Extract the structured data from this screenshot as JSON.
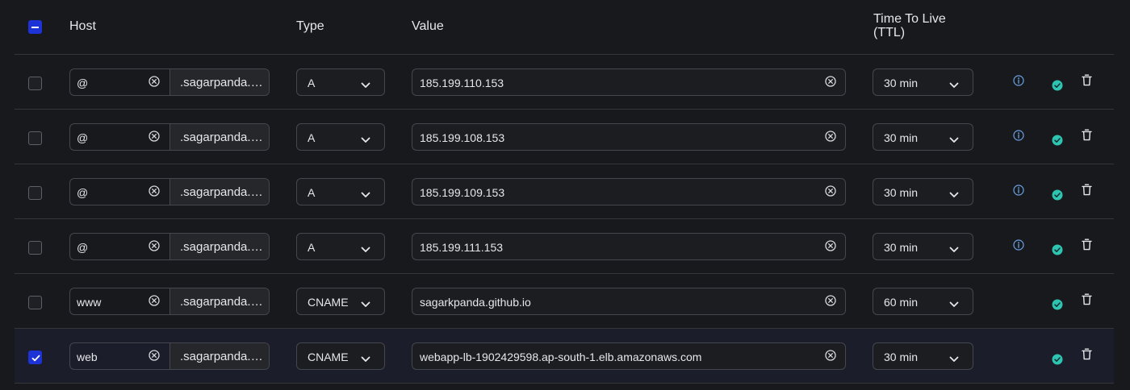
{
  "header": {
    "host": "Host",
    "type": "Type",
    "value": "Value",
    "ttl_line1": "Time To Live",
    "ttl_line2": "(TTL)"
  },
  "colors": {
    "accent": "#1d33d6",
    "status_ok": "#2fc4b2",
    "info": "#6aa3e6"
  },
  "rows": [
    {
      "checked": false,
      "host": "@",
      "domain": ".sagarpanda.com",
      "type": "A",
      "value": "185.199.110.153",
      "ttl": "30 min",
      "info": true
    },
    {
      "checked": false,
      "host": "@",
      "domain": ".sagarpanda.com",
      "type": "A",
      "value": "185.199.108.153",
      "ttl": "30 min",
      "info": true
    },
    {
      "checked": false,
      "host": "@",
      "domain": ".sagarpanda.com",
      "type": "A",
      "value": "185.199.109.153",
      "ttl": "30 min",
      "info": true
    },
    {
      "checked": false,
      "host": "@",
      "domain": ".sagarpanda.com",
      "type": "A",
      "value": "185.199.111.153",
      "ttl": "30 min",
      "info": true
    },
    {
      "checked": false,
      "host": "www",
      "domain": ".sagarpanda.com",
      "type": "CNAME",
      "value": "sagarkpanda.github.io",
      "ttl": "60 min",
      "info": false
    },
    {
      "checked": true,
      "host": "web",
      "domain": ".sagarpanda.com",
      "type": "CNAME",
      "value": "webapp-lb-1902429598.ap-south-1.elb.amazonaws.com",
      "ttl": "30 min",
      "info": false
    }
  ]
}
